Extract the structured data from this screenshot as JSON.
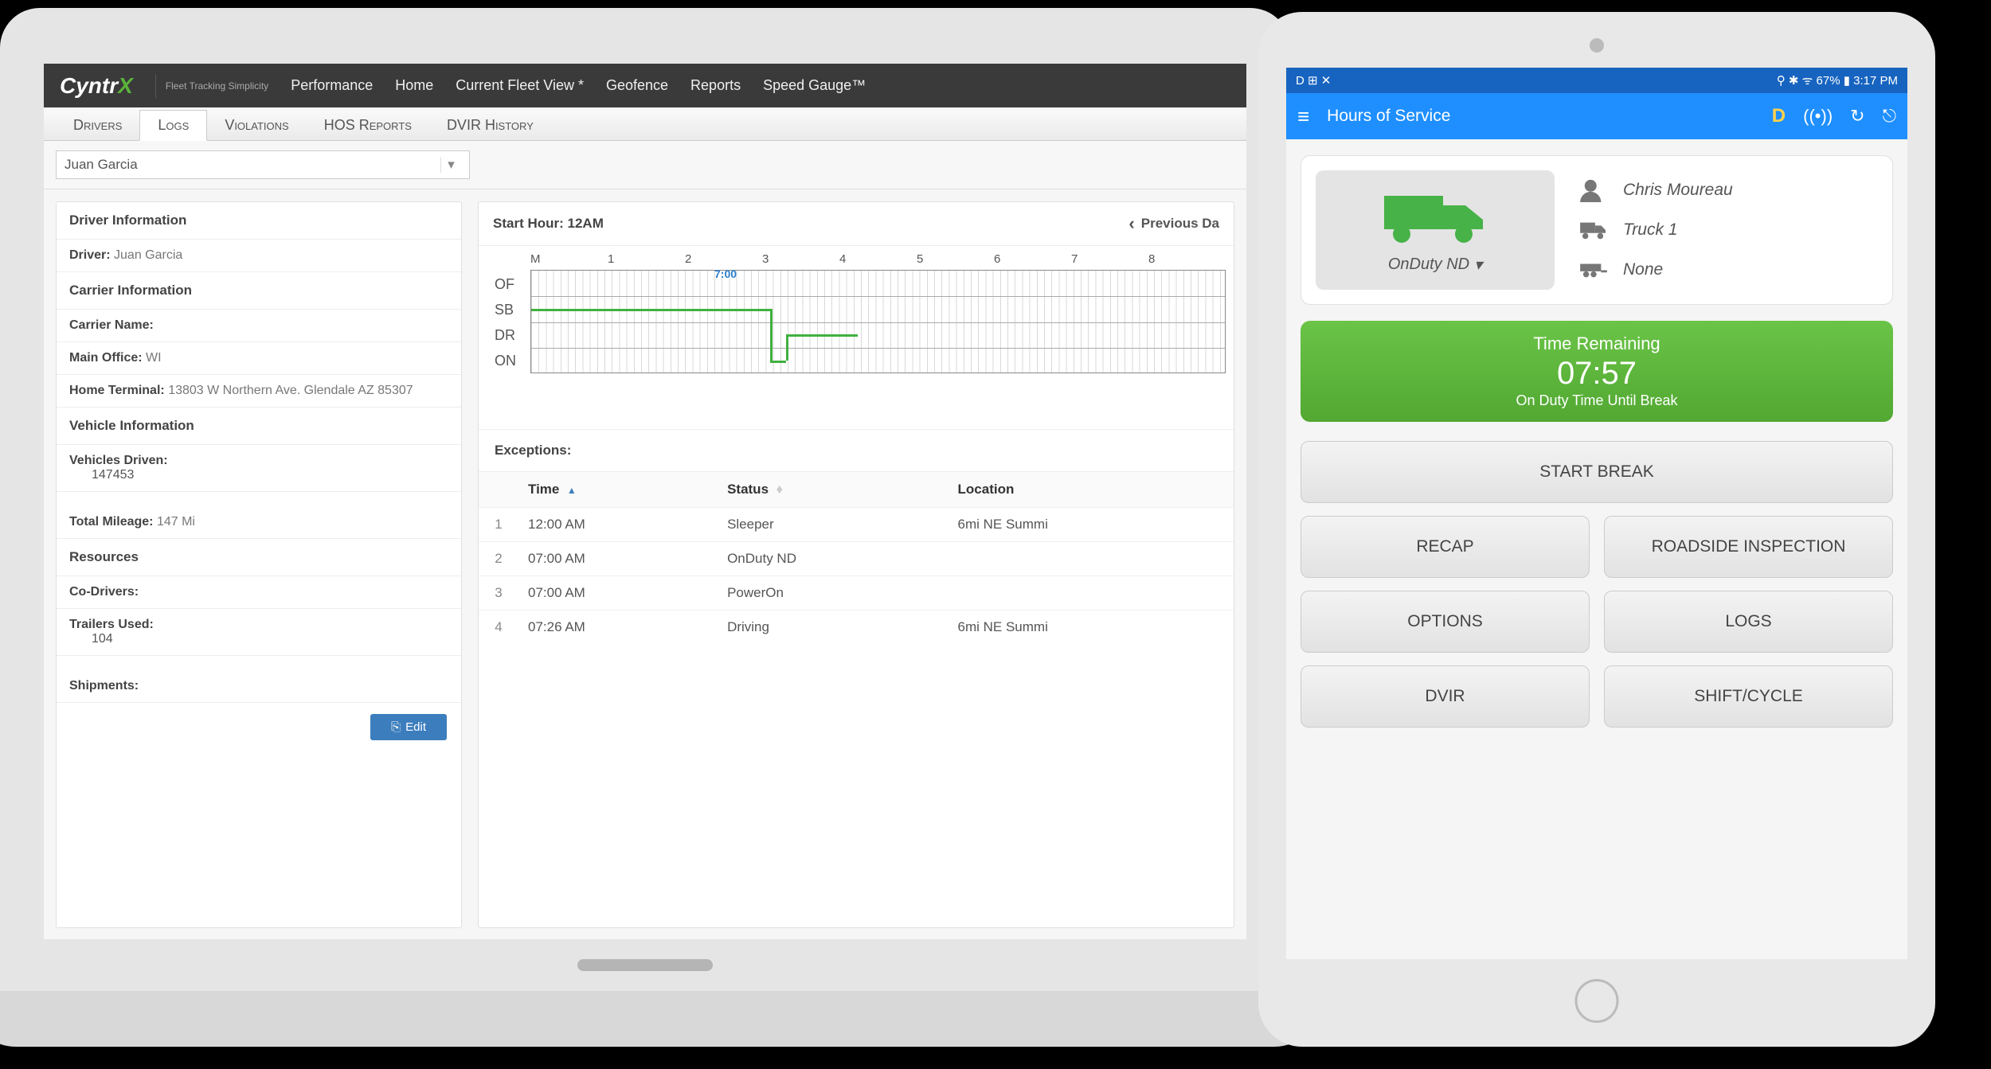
{
  "desktop": {
    "brand": "Cyntr",
    "brand_x": "X",
    "tagline": "Fleet Tracking Simplicity",
    "nav": [
      "Performance",
      "Home",
      "Current Fleet View *",
      "Geofence",
      "Reports",
      "Speed Gauge™"
    ],
    "subtabs": [
      "Drivers",
      "Logs",
      "Violations",
      "HOS Reports",
      "DVIR History"
    ],
    "active_subtab": "Logs",
    "driver_selected": "Juan Garcia",
    "left_panel": {
      "driver_info_title": "Driver Information",
      "driver_label": "Driver:",
      "driver_value": "Juan Garcia",
      "carrier_info_title": "Carrier Information",
      "carrier_name_label": "Carrier Name:",
      "carrier_name_value": "",
      "main_office_label": "Main Office:",
      "main_office_value": "WI",
      "home_terminal_label": "Home Terminal:",
      "home_terminal_value": "13803 W Northern Ave. Glendale AZ 85307",
      "vehicle_info_title": "Vehicle Information",
      "vehicles_driven_label": "Vehicles Driven:",
      "vehicles_driven_value": "147453",
      "total_mileage_label": "Total Mileage:",
      "total_mileage_value": "147 Mi",
      "resources_title": "Resources",
      "codrivers_label": "Co-Drivers:",
      "trailers_label": "Trailers Used:",
      "trailers_value": "104",
      "shipments_label": "Shipments:",
      "edit_btn": "Edit"
    },
    "right_panel": {
      "start_hour_label": "Start Hour:",
      "start_hour_value": "12AM",
      "prev_day": "Previous Da",
      "graph_labels": [
        "OF",
        "SB",
        "DR",
        "ON"
      ],
      "graph_hours": [
        "M",
        "1",
        "2",
        "3",
        "4",
        "5",
        "6",
        "7",
        "8"
      ],
      "graph_time_marker": "7:00",
      "exceptions_label": "Exceptions:",
      "columns": [
        "Time",
        "Status",
        "Location"
      ],
      "rows": [
        {
          "n": "1",
          "time": "12:00 AM",
          "status": "Sleeper",
          "status_cls": "sleeper",
          "loc": "6mi NE Summi"
        },
        {
          "n": "2",
          "time": "07:00 AM",
          "status": "OnDuty ND",
          "status_cls": "onduty",
          "loc": ""
        },
        {
          "n": "3",
          "time": "07:00 AM",
          "status": "PowerOn",
          "status_cls": "poweron",
          "loc": ""
        },
        {
          "n": "4",
          "time": "07:26 AM",
          "status": "Driving",
          "status_cls": "driving",
          "loc": "6mi NE Summi"
        }
      ]
    }
  },
  "tablet": {
    "status_left": "D ⊞ ✕",
    "status_right": "⚲ ✱ ᯤ 67% ▮ 3:17 PM",
    "app_title": "Hours of Service",
    "d_badge": "D",
    "driver_name": "Chris Moureau",
    "truck_name": "Truck 1",
    "trailer_name": "None",
    "veh_status": "OnDuty ND",
    "time_remaining_label": "Time Remaining",
    "time_remaining_value": "07:57",
    "time_remaining_sub": "On Duty Time Until Break",
    "btn_start_break": "START BREAK",
    "btn_recap": "RECAP",
    "btn_roadside": "ROADSIDE INSPECTION",
    "btn_options": "OPTIONS",
    "btn_logs": "LOGS",
    "btn_dvir": "DVIR",
    "btn_shift": "SHIFT/CYCLE"
  }
}
